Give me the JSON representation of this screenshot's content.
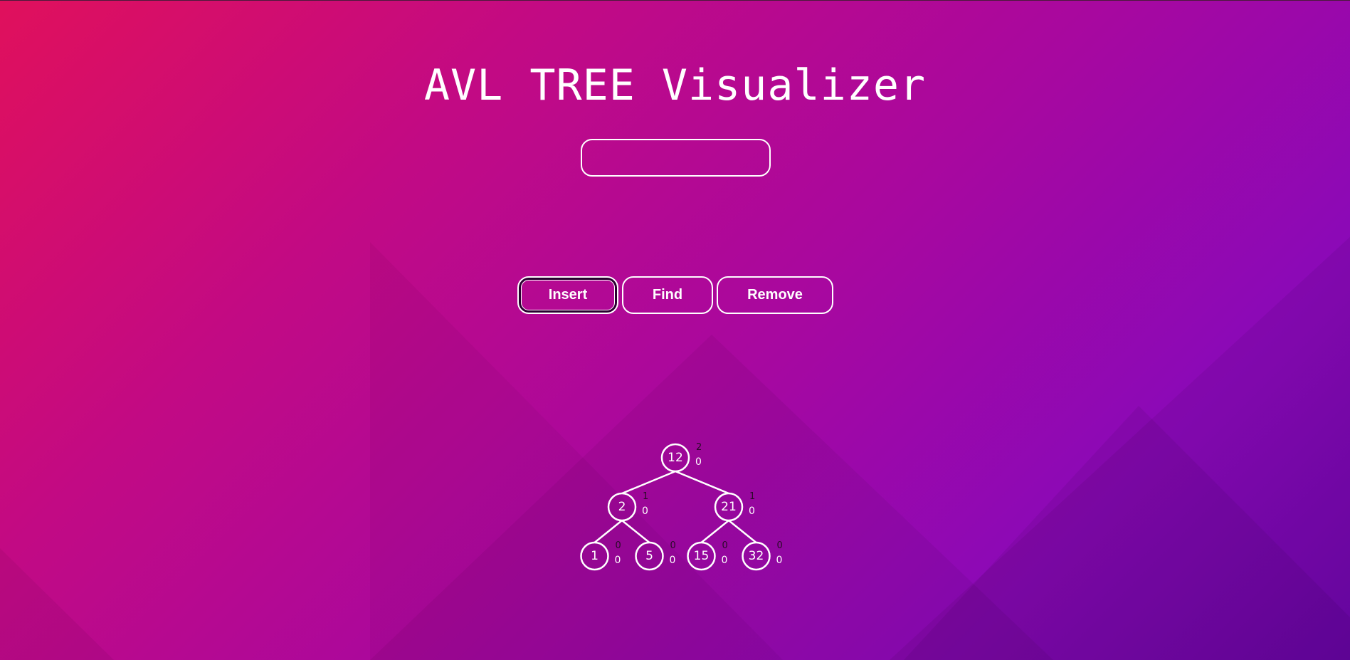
{
  "page": {
    "title": "AVL TREE Visualizer"
  },
  "input": {
    "value": "",
    "placeholder": ""
  },
  "buttons": {
    "insert": "Insert",
    "find": "Find",
    "remove": "Remove"
  },
  "colors": {
    "gradient_start": "#e0105c",
    "gradient_end": "#6a06a8",
    "foreground": "#ffffff",
    "height_label": "#2a0a28"
  },
  "tree": {
    "root": {
      "key": "12",
      "height": "2",
      "balance": "0",
      "left": {
        "key": "2",
        "height": "1",
        "balance": "0",
        "left": {
          "key": "1",
          "height": "0",
          "balance": "0"
        },
        "right": {
          "key": "5",
          "height": "0",
          "balance": "0"
        }
      },
      "right": {
        "key": "21",
        "height": "1",
        "balance": "0",
        "left": {
          "key": "15",
          "height": "0",
          "balance": "0"
        },
        "right": {
          "key": "32",
          "height": "0",
          "balance": "0"
        }
      }
    }
  }
}
